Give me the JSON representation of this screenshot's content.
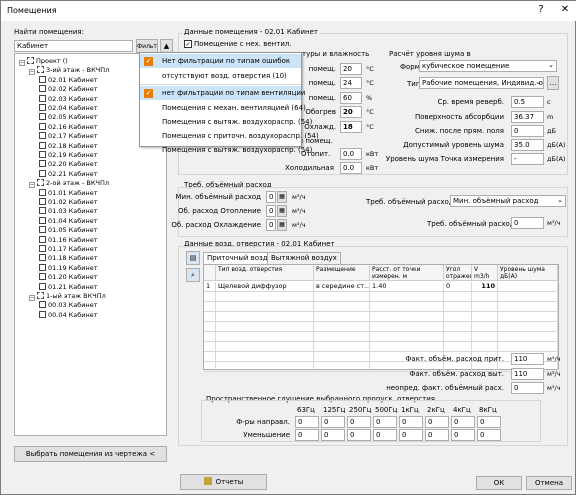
{
  "window": {
    "title": "Помещения",
    "help": "?",
    "close": "✕"
  },
  "search": {
    "label": "Найти помещения:",
    "value": "Кабинет",
    "filter_label": "Фильтр"
  },
  "tree": [
    {
      "depth": 0,
      "label": "Проект ()",
      "icon": "project"
    },
    {
      "depth": 1,
      "label": "3-ий этаж - ВКЧПл",
      "icon": "floor"
    },
    {
      "depth": 2,
      "label": "02.01 Кабинет",
      "icon": "room"
    },
    {
      "depth": 2,
      "label": "02.02 Кабинет",
      "icon": "room"
    },
    {
      "depth": 2,
      "label": "02.03 Кабинет",
      "icon": "room"
    },
    {
      "depth": 2,
      "label": "02.04 Кабинет",
      "icon": "room"
    },
    {
      "depth": 2,
      "label": "02.05 Кабинет",
      "icon": "room"
    },
    {
      "depth": 2,
      "label": "02.16 Кабинет",
      "icon": "room"
    },
    {
      "depth": 2,
      "label": "02.17 Кабинет",
      "icon": "room"
    },
    {
      "depth": 2,
      "label": "02.18 Кабинет",
      "icon": "room"
    },
    {
      "depth": 2,
      "label": "02.19 Кабинет",
      "icon": "room"
    },
    {
      "depth": 2,
      "label": "02.20 Кабинет",
      "icon": "room"
    },
    {
      "depth": 2,
      "label": "02.21 Кабинет",
      "icon": "room"
    },
    {
      "depth": 1,
      "label": "2-ой этаж - ВКЧПл",
      "icon": "floor"
    },
    {
      "depth": 2,
      "label": "01.01 Кабинет",
      "icon": "room"
    },
    {
      "depth": 2,
      "label": "01.02 Кабинет",
      "icon": "room"
    },
    {
      "depth": 2,
      "label": "01.03 Кабинет",
      "icon": "room"
    },
    {
      "depth": 2,
      "label": "01.04 Кабинет",
      "icon": "room"
    },
    {
      "depth": 2,
      "label": "01.05 Кабинет",
      "icon": "room"
    },
    {
      "depth": 2,
      "label": "01.16 Кабинет",
      "icon": "room"
    },
    {
      "depth": 2,
      "label": "01.17 Кабинет",
      "icon": "room"
    },
    {
      "depth": 2,
      "label": "01.18 Кабинет",
      "icon": "room"
    },
    {
      "depth": 2,
      "label": "01.19 Кабинет",
      "icon": "room"
    },
    {
      "depth": 2,
      "label": "01.20 Кабинет",
      "icon": "room"
    },
    {
      "depth": 2,
      "label": "01.21 Кабинет",
      "icon": "room"
    },
    {
      "depth": 1,
      "label": "1-ый этаж ВКЧПл",
      "icon": "floor"
    },
    {
      "depth": 2,
      "label": "00.03 Кабинет",
      "icon": "room"
    },
    {
      "depth": 2,
      "label": "00.04 Кабинет",
      "icon": "room"
    }
  ],
  "select_from_drawing": "Выбрать помещения из чертежа <",
  "popup": {
    "items": [
      {
        "label": "Нет фильтрации по типам ошибок",
        "checked": true
      },
      {
        "label": "отсутствуют возд. отверстия (10)",
        "checked": false
      },
      {
        "label": "нет фильтрации по типам вентиляции",
        "checked": true
      },
      {
        "label": "Помещения с механ. вентиляцией (64)",
        "checked": false
      },
      {
        "label": "Помещения с вытяж. воздухораспр. (54)",
        "checked": false
      },
      {
        "label": "Помещения с приточн. воздухораспр. (54)",
        "checked": false
      },
      {
        "label": "Помещения с вытяж. воздухораспр. (54)",
        "checked": false
      }
    ]
  },
  "room_data": {
    "title": "Данные помещения - 02.01 Кабинет",
    "nonvent_checkbox": "Помещение с нех. вентил.",
    "temp_header": "туры и влажность",
    "rows": [
      {
        "label": "помещ.",
        "value": "20",
        "unit": "°С"
      },
      {
        "label": "помещ.",
        "value": "24",
        "unit": "°С"
      },
      {
        "label": "помещ.",
        "value": "60",
        "unit": "%"
      },
      {
        "label": "Обогрев",
        "value": "20",
        "unit": "°С"
      },
      {
        "label": "Охлажд.",
        "value": "18",
        "unit": "°С"
      }
    ],
    "heat_label": "Отопит.",
    "heat_value": "0.0",
    "heat_unit": "кВт",
    "cool_label": "Холодильная",
    "cool_value": "0.0",
    "cool_unit": "кВт",
    "partial_label": "ии помещ."
  },
  "noise": {
    "title": "Расчёт уровня шума в",
    "form_label": "Форма",
    "form_value": "кубическое помещение",
    "type_label": "Тип",
    "type_value": "Рабочие помещения, Индивид. офис",
    "rows": [
      {
        "label": "Ср. время реверб.",
        "value": "0.5",
        "unit": "с"
      },
      {
        "label": "Поверхность абсорбции",
        "value": "36.37",
        "unit": "m"
      },
      {
        "label": "Сниж. после прям. поля",
        "value": "0",
        "unit": "дБ"
      },
      {
        "label": "Допустимый уровень шума",
        "value": "35.0",
        "unit": "дБ(A)"
      },
      {
        "label": "Уровень шума Точка измерения",
        "value": "-",
        "unit": "дБ(A)"
      }
    ]
  },
  "airflow": {
    "title": "Треб. объёмный расход",
    "rows": [
      {
        "label": "Мин. объёмный расход",
        "value": "0",
        "unit": "м³/ч"
      },
      {
        "label": "Об. расход Отопление",
        "value": "0",
        "unit": "м³/ч"
      },
      {
        "label": "Об. расход Охлаждение",
        "value": "0",
        "unit": "м³/ч"
      }
    ],
    "from_label": "Треб. объёмный расход из:",
    "from_value": "Мин. объёмный расход",
    "req_label": "Треб. объёмный расход",
    "req_value": "0",
    "req_unit": "м³/ч"
  },
  "openings": {
    "title": "Данные возд. отверстия - 02.01 Кабинет",
    "tabs": [
      "Приточный воздух",
      "Вытяжной воздух"
    ],
    "columns": [
      "",
      "Тип возд. отверстия",
      "Размещение",
      "Расст. от точки измерен. м",
      "Угол отражен.",
      "V m3/h",
      "Уровень шума дБ(A)"
    ],
    "rows": [
      [
        "1",
        "Щелевой диффузор",
        "в середине ст...",
        "1.40",
        "0",
        "110",
        ""
      ]
    ]
  },
  "totals": [
    {
      "label": "Факт. объём. расход прит.",
      "value": "110",
      "unit": "м³/ч"
    },
    {
      "label": "Факт. объём. расход выт.",
      "value": "110",
      "unit": "м³/ч"
    },
    {
      "label": "неопред. факт. объёмный расх.",
      "value": "0",
      "unit": "м³/ч"
    }
  ],
  "attenuation": {
    "title": "Пространственное глушение выбранного пропуск. отверстия",
    "freqs": [
      "63Гц",
      "125Гц",
      "250Гц",
      "500Гц",
      "1кГц",
      "2кГц",
      "4кГц",
      "8кГц"
    ],
    "rows": [
      {
        "label": "Ф-ры направл.",
        "values": [
          "0",
          "0",
          "0",
          "0",
          "0",
          "0",
          "0",
          "0"
        ]
      },
      {
        "label": "Уменьшение",
        "values": [
          "0",
          "0",
          "0",
          "0",
          "0",
          "0",
          "0",
          "0"
        ]
      }
    ]
  },
  "footer": {
    "reports": "Отчеты",
    "ok": "ОК",
    "cancel": "Отмена"
  },
  "colors": {
    "accent": "#0078d7",
    "check": "#e67e00",
    "highlight": "#cce4f7"
  }
}
